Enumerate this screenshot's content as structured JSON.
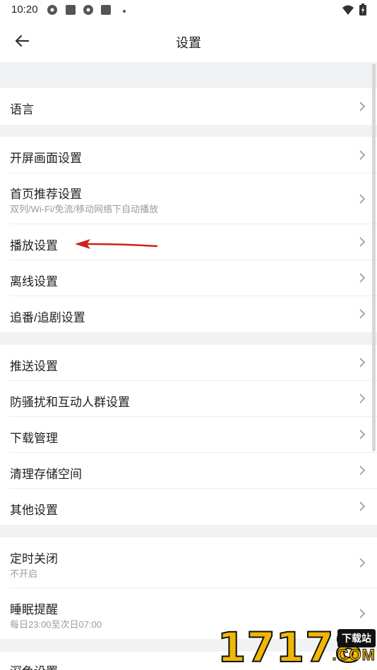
{
  "status_bar": {
    "time": "10:20",
    "icons": [
      "app-icon",
      "square-icon",
      "app-icon",
      "square-icon",
      "dot-icon"
    ],
    "right_icons": [
      "wifi-icon",
      "battery-icon"
    ]
  },
  "header": {
    "title": "设置",
    "back_icon": "arrow-left-icon"
  },
  "sections": [
    {
      "items": [
        {
          "label": "语言"
        }
      ]
    },
    {
      "items": [
        {
          "label": "开屏画面设置"
        },
        {
          "label": "首页推荐设置",
          "sub": "双列/Wi-Fi/免流/移动网络下自动播放"
        },
        {
          "label": "播放设置"
        },
        {
          "label": "离线设置"
        },
        {
          "label": "追番/追剧设置"
        }
      ]
    },
    {
      "items": [
        {
          "label": "推送设置"
        },
        {
          "label": "防骚扰和互动人群设置"
        },
        {
          "label": "下载管理"
        },
        {
          "label": "清理存储空间"
        },
        {
          "label": "其他设置"
        }
      ]
    },
    {
      "items": [
        {
          "label": "定时关闭",
          "sub": "不开启"
        },
        {
          "label": "睡眠提醒",
          "sub": "每日23:00至次日07:00"
        }
      ]
    },
    {
      "items": [
        {
          "label": "深色设置"
        }
      ]
    }
  ],
  "annotation": {
    "color": "#d11f1f"
  },
  "watermark": {
    "digits": "17178",
    "badge": "下载站",
    "suffix": ".COM",
    "color": "#f2b705"
  },
  "colors": {
    "background": "#f1f2f3",
    "row": "#ffffff",
    "text": "#212121",
    "subtext": "#9a9a9a"
  }
}
